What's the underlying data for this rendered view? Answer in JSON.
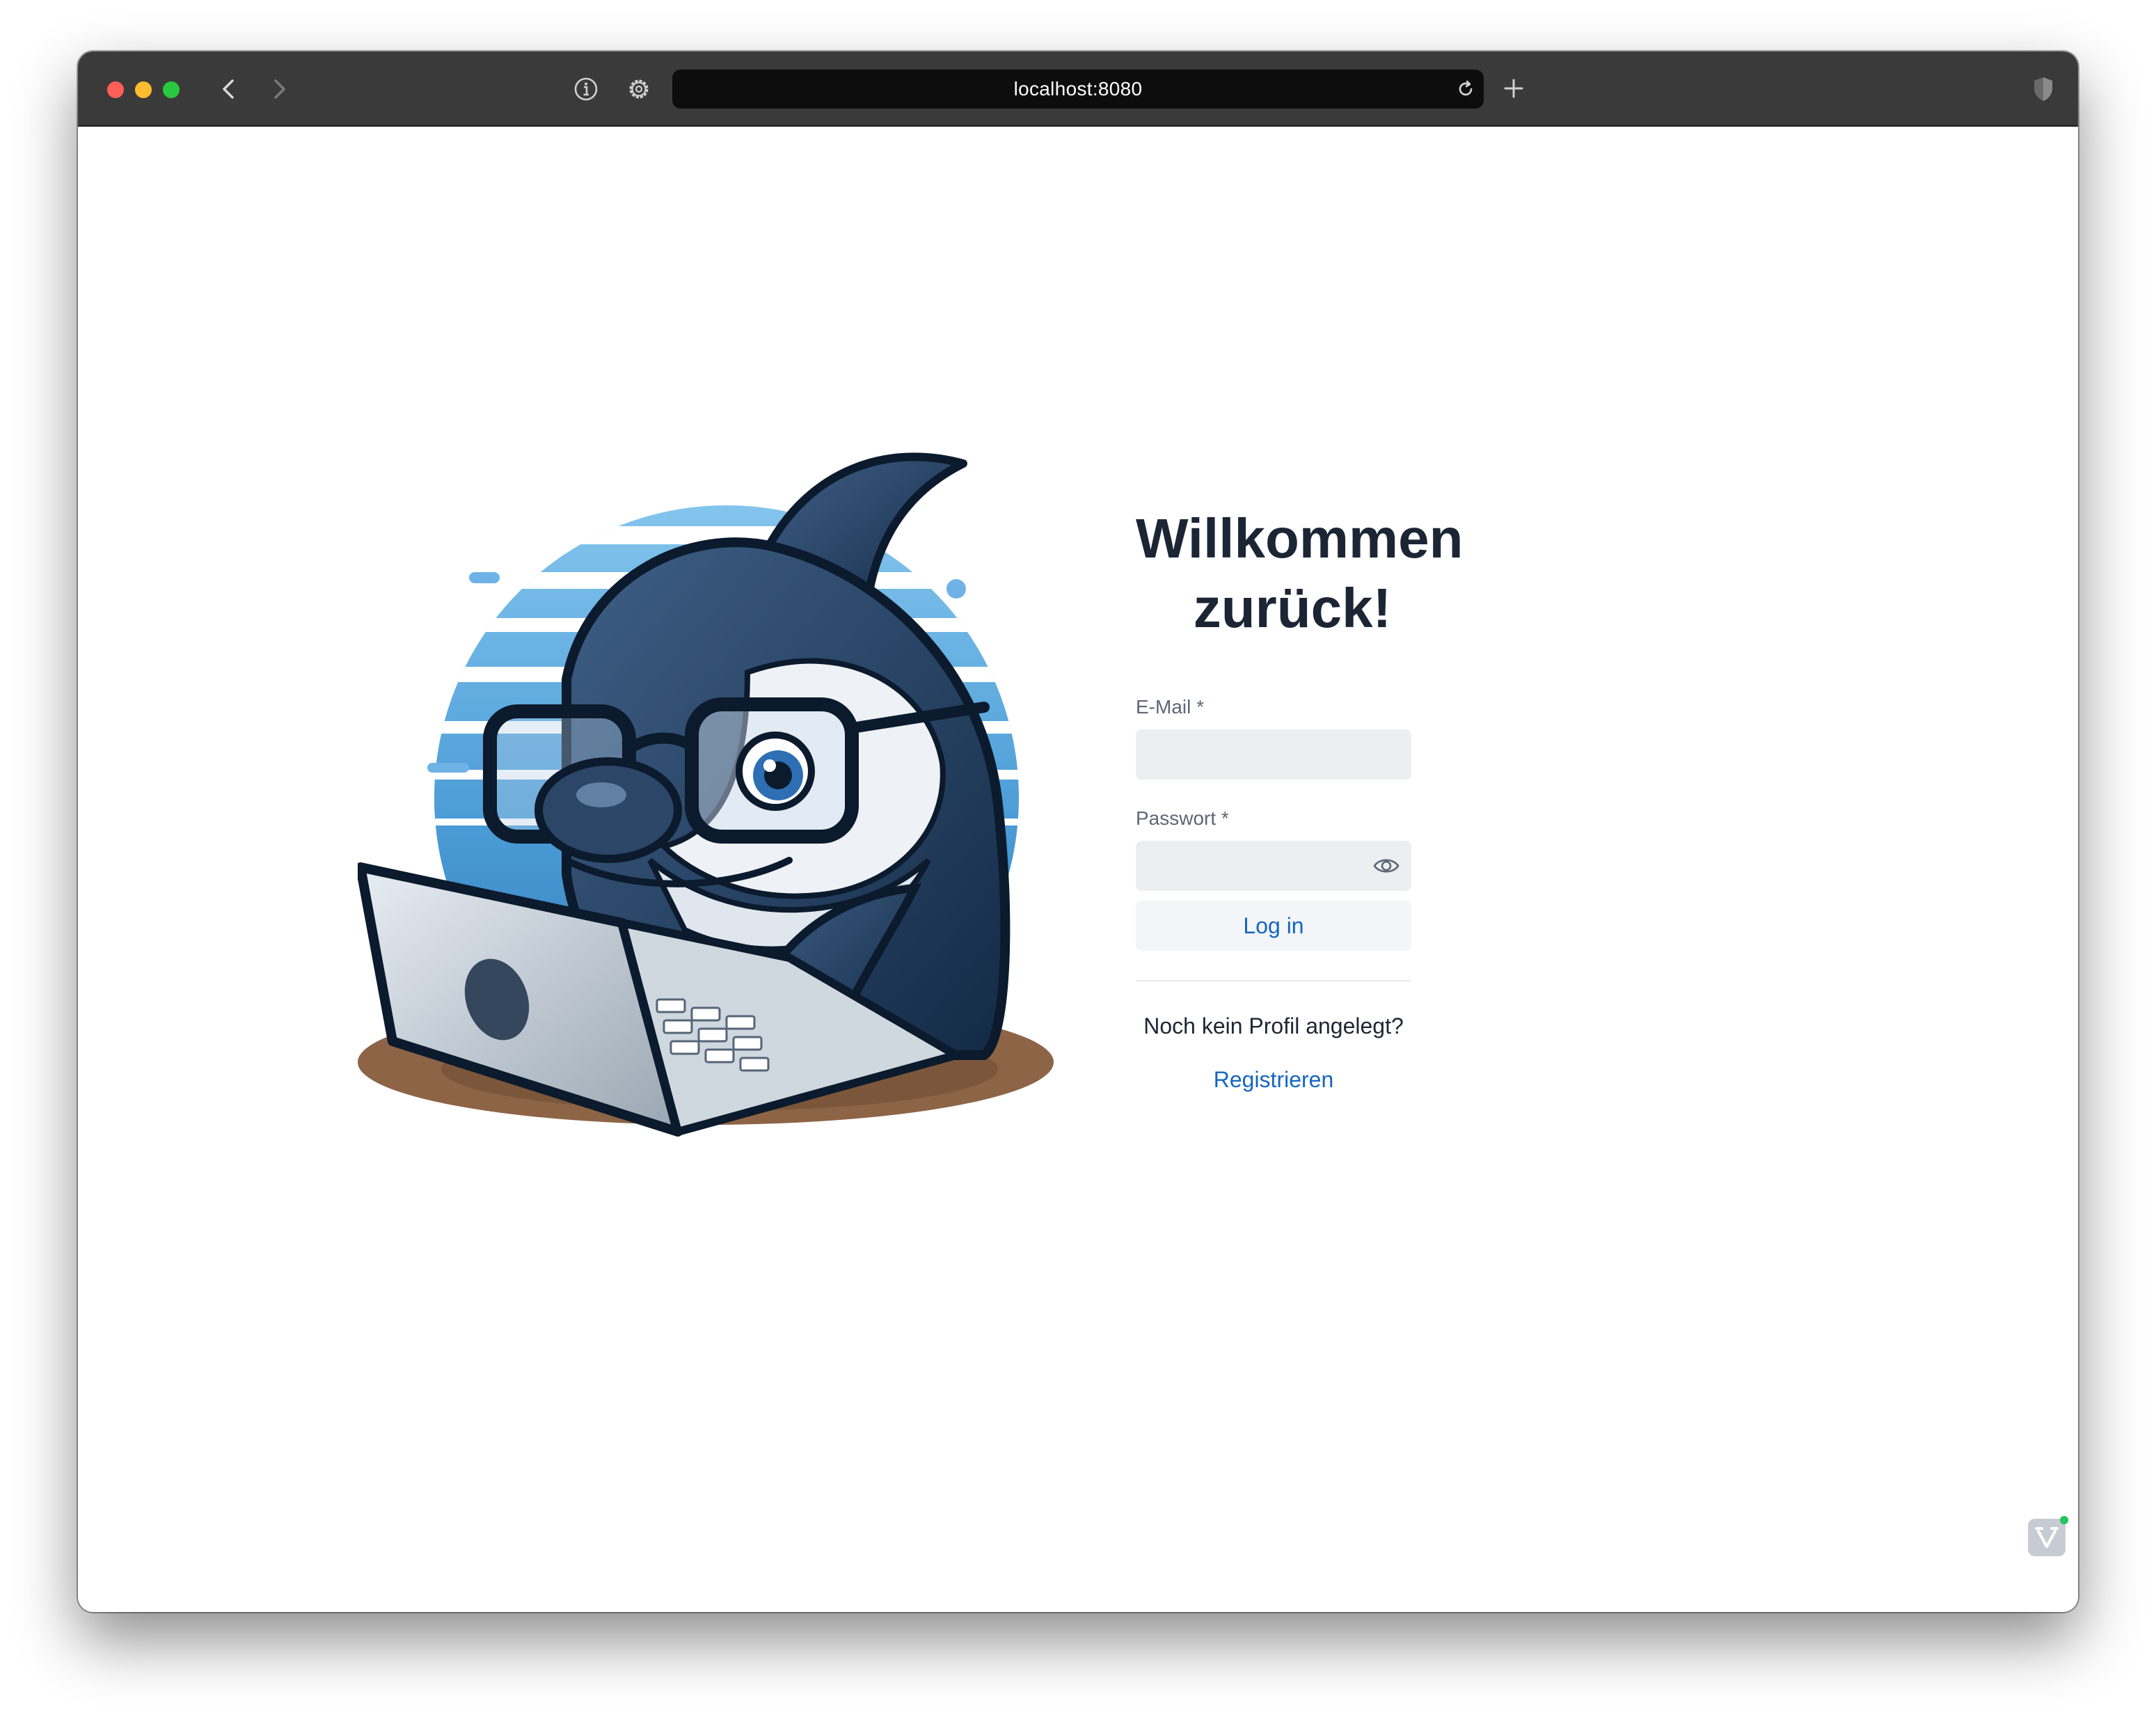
{
  "browser": {
    "url": "localhost:8080"
  },
  "login": {
    "title": "Willkommen zurück!",
    "email_label": "E-Mail *",
    "email_value": "",
    "password_label": "Passwort *",
    "password_value": "",
    "login_button": "Log in",
    "no_profile_text": "Noch kein Profil angelegt?",
    "register_link": "Registrieren"
  },
  "colors": {
    "accent": "#1466c1",
    "heading": "#1c2533",
    "field_bg": "#eceef1",
    "titlebar": "#3a3a3a"
  },
  "icons": {
    "hero": "orca-with-glasses-and-laptop",
    "password_toggle": "eye-icon",
    "dev_tools": "dev-tools-icon"
  }
}
